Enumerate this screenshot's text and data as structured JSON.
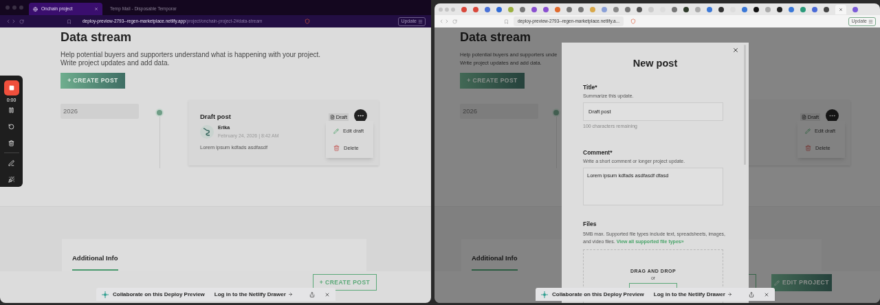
{
  "left_window": {
    "tabs": [
      {
        "label": "Onchain project",
        "selected": true
      },
      {
        "label": "Temp Mail - Disposable Temporar",
        "selected": false
      }
    ],
    "address": {
      "host": "deploy-preview-2793--regen-marketplace.netlify.app",
      "path": "/project/onchain-project-2#data-stream"
    },
    "update_button": "Update",
    "recorder": {
      "time": "0:00"
    },
    "page": {
      "heading": "Data stream",
      "description": [
        "Help potential buyers and supporters understand what is happening with your project.",
        "Write project updates and add data."
      ],
      "create_button": "+ CREATE POST",
      "year": "2026",
      "post": {
        "title": "Draft post",
        "author": "Erika",
        "date": "February 24, 2026 | 8:42 AM",
        "body": "Lorem ipsum kdfads asdfasdf",
        "badge": "Draft"
      },
      "menu": [
        {
          "kind": "edit",
          "label": "Edit draft"
        },
        {
          "kind": "delete",
          "label": "Delete"
        }
      ],
      "section_tab": "Additional Info",
      "bottom_buttons": [
        {
          "kind": "outline",
          "label": "+ CREATE POST"
        }
      ]
    },
    "netlify_bar": {
      "message": "Collaborate on this Deploy Preview",
      "login_link": "Log in to the Netlify Drawer"
    }
  },
  "right_window": {
    "address": "deploy-preview-2793--regen-marketplace.netlify.a...",
    "update_button": "Update",
    "page": {
      "heading": "Data stream",
      "description": [
        "Help potential buyers and supporters unde",
        "Write project updates and add data."
      ],
      "create_button": "+ CREATE POST",
      "year": "2026",
      "post": {
        "badge": "Draft"
      },
      "menu": [
        {
          "kind": "edit",
          "label": "Edit draft"
        },
        {
          "kind": "delete",
          "label": "Delete"
        }
      ],
      "section_tab": "Additional Info",
      "bottom_buttons": [
        {
          "kind": "outline"
        },
        {
          "kind": "filled",
          "label": "EDIT PROJECT"
        }
      ]
    },
    "modal": {
      "title": "New post",
      "fields": [
        {
          "kind": "input",
          "label": "Title*",
          "hint": "Summarize this update.",
          "value": "Draft post",
          "counter": "100 characters remaining"
        },
        {
          "kind": "textarea",
          "label": "Comment*",
          "hint": "Write a short comment or longer project update.",
          "value": "Lorem ipsum kdfads asdfasdf dfasd"
        }
      ],
      "files": {
        "label": "Files",
        "description": "5MB max. Supported file types include text, spreadsheets, images, and video files.",
        "link": "View all supported file types»",
        "drop_text": "DRAG AND DROP",
        "or": "or"
      }
    },
    "netlify_bar": {
      "message": "Collaborate on this Deploy Preview",
      "login_link": "Log in to the Netlify Drawer"
    }
  }
}
